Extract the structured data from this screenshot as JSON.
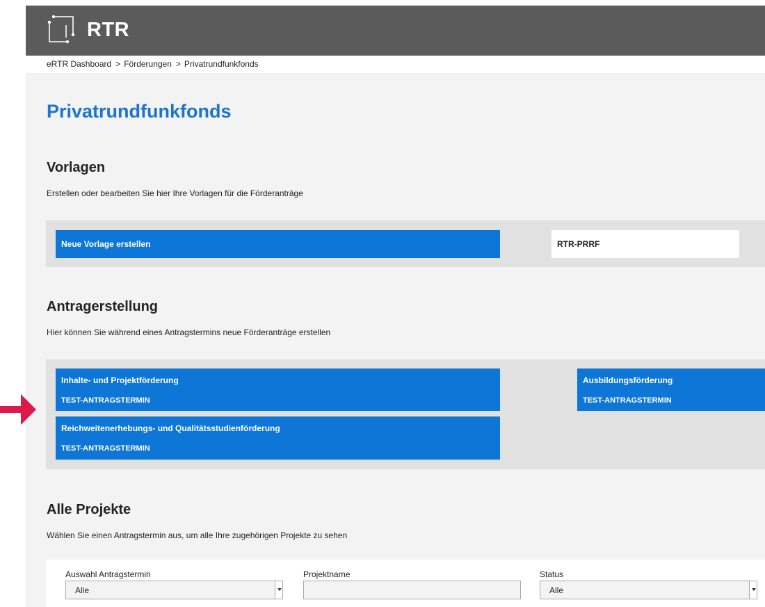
{
  "app": {
    "logo_text": "RTR"
  },
  "breadcrumb": [
    "eRTR Dashboard",
    "Förderungen",
    "Privatrundfunkfonds"
  ],
  "page": {
    "title": "Privatrundfunkfonds"
  },
  "vorlagen": {
    "title": "Vorlagen",
    "description": "Erstellen oder bearbeiten Sie hier Ihre Vorlagen für die Förderanträge",
    "new_button": "Neue Vorlage erstellen",
    "template_name": "RTR-PRRF"
  },
  "antrag": {
    "title": "Antragerstellung",
    "description": "Hier können Sie während eines Antragstermins neue Förderanträge erstellen",
    "tiles": [
      {
        "title": "Inhalte- und Projektförderung",
        "subtitle": "TEST-ANTRAGSTERMIN"
      },
      {
        "title": "Ausbildungsförderung",
        "subtitle": "TEST-ANTRAGSTERMIN"
      },
      {
        "title": "Reichweitenerhebungs- und Qualitätsstudienförderung",
        "subtitle": "TEST-ANTRAGSTERMIN"
      }
    ]
  },
  "projekte": {
    "title": "Alle Projekte",
    "description": "Wählen Sie einen Antragstermin aus, um alle Ihre zugehörigen Projekte zu sehen",
    "filters": {
      "termin_label": "Auswahl Antragstermin",
      "termin_value": "Alle",
      "name_label": "Projektname",
      "name_value": "",
      "status_label": "Status",
      "status_value": "Alle"
    }
  },
  "colors": {
    "accent": "#0e76d6",
    "title_blue": "#1b74d1",
    "header": "#5b5b5b",
    "annotation_arrow": "#e0194b"
  },
  "icons": {
    "logo": "rtr-logo-icon",
    "separator": "chevron-right-icon",
    "dropdown": "chevron-down-icon",
    "annotation": "arrow-right-icon"
  }
}
